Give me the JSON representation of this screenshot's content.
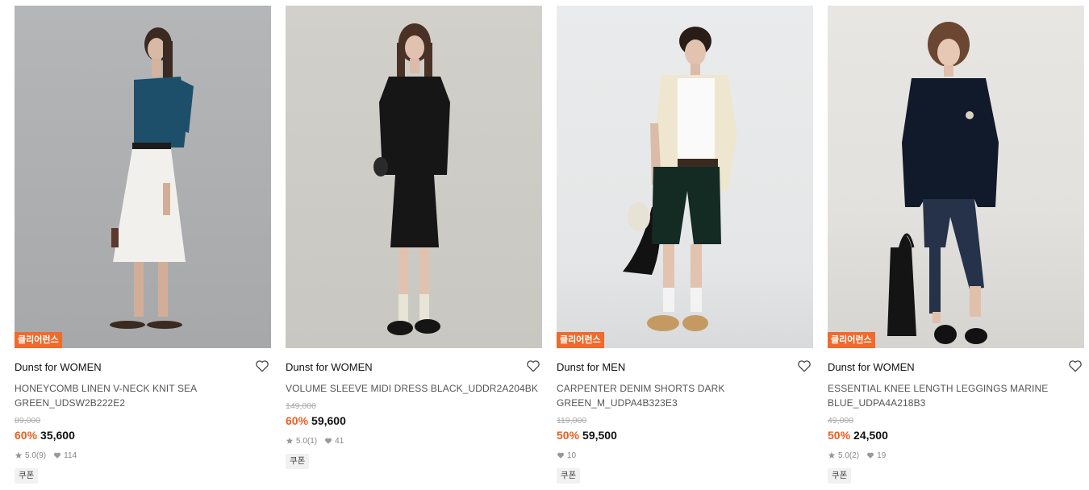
{
  "colors": {
    "accent": "#ef5d1f",
    "tag_bg": "#f06a2c",
    "muted": "#888888"
  },
  "products": [
    {
      "tag": "클리어런스",
      "brand": "Dunst for WOMEN",
      "name": "HONEYCOMB LINEN V-NECK KNIT SEA GREEN_UDSW2B222E2",
      "original_price": "89,000",
      "discount": "60%",
      "price": "35,600",
      "rating": "5.0",
      "reviews": "(9)",
      "likes": "114",
      "coupon": "쿠폰"
    },
    {
      "tag": "",
      "brand": "Dunst for WOMEN",
      "name": "VOLUME SLEEVE MIDI DRESS BLACK_UDDR2A204BK",
      "original_price": "149,000",
      "discount": "60%",
      "price": "59,600",
      "rating": "5.0",
      "reviews": "(1)",
      "likes": "41",
      "coupon": "쿠폰"
    },
    {
      "tag": "클리어런스",
      "brand": "Dunst for MEN",
      "name": "CARPENTER DENIM SHORTS DARK GREEN_M_UDPA4B323E3",
      "original_price": "119,000",
      "discount": "50%",
      "price": "59,500",
      "rating": "",
      "reviews": "",
      "likes": "10",
      "coupon": "쿠폰"
    },
    {
      "tag": "클리어런스",
      "brand": "Dunst for WOMEN",
      "name": "ESSENTIAL KNEE LENGTH LEGGINGS MARINE BLUE_UDPA4A218B3",
      "original_price": "49,000",
      "discount": "50%",
      "price": "24,500",
      "rating": "5.0",
      "reviews": "(2)",
      "likes": "19",
      "coupon": "쿠폰"
    }
  ]
}
